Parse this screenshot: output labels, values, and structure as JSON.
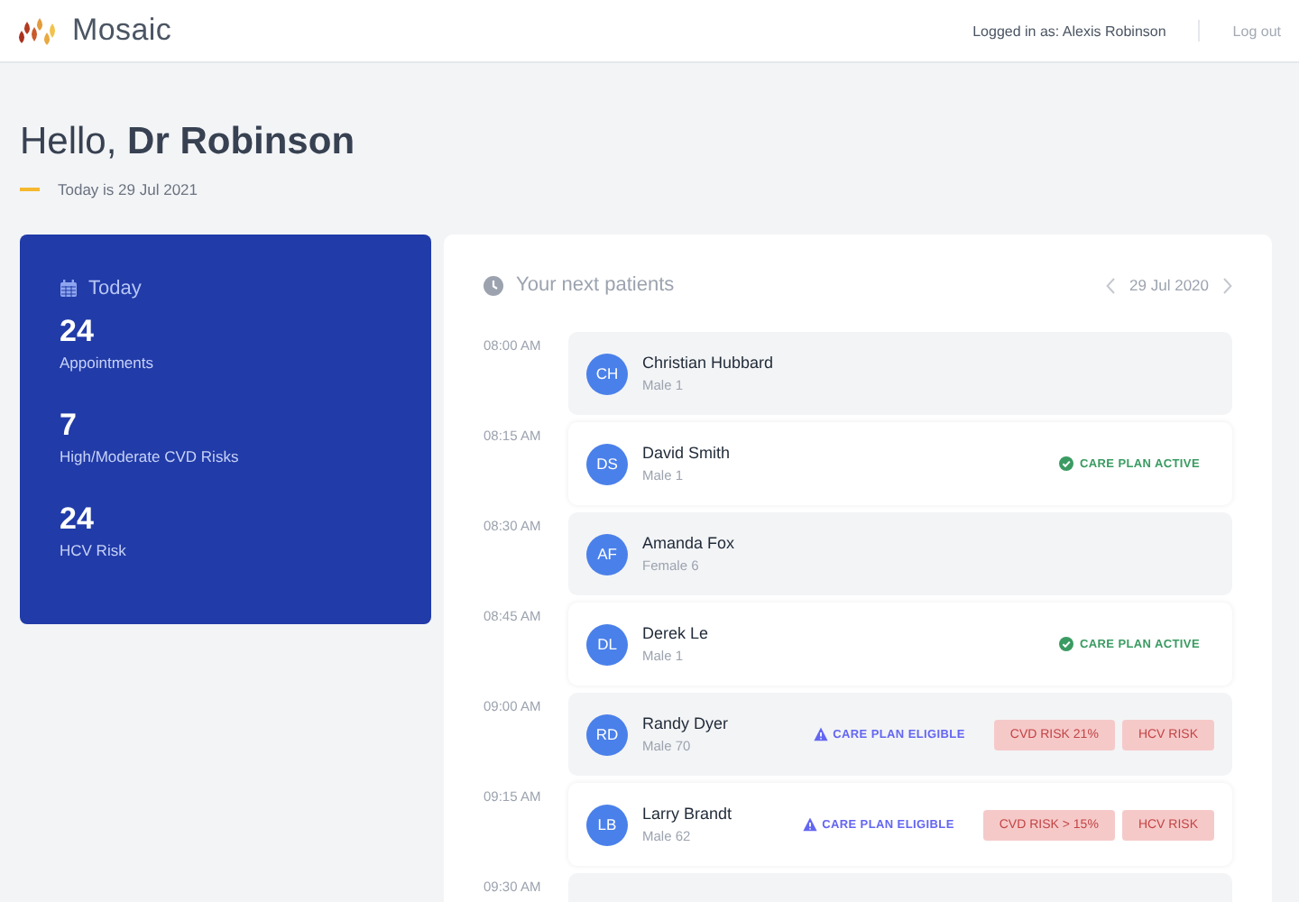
{
  "header": {
    "brand": "Mosaic",
    "logged_in": "Logged in as: Alexis Robinson",
    "logout": "Log out"
  },
  "greeting": {
    "text": "Hello, **Dr Robinson**",
    "date": "Today is 29 Jul 2021"
  },
  "today": {
    "title": "Today",
    "stats": [
      {
        "value": "24",
        "label": "Appointments"
      },
      {
        "value": "7",
        "label": "High/Moderate CVD Risks"
      },
      {
        "value": "24",
        "label": "HCV Risk"
      }
    ]
  },
  "patients": {
    "title": "Your next patients",
    "date": "29 Jul 2020",
    "slots": [
      {
        "time": "08:00 AM",
        "initials": "CH",
        "name": "Christian Hubbard",
        "detail": "Male 1"
      },
      {
        "time": "08:15 AM",
        "initials": "DS",
        "name": "David Smith",
        "detail": "Male 1",
        "care_plan": {
          "kind": "active",
          "label": "CARE PLAN ACTIVE"
        }
      },
      {
        "time": "08:30 AM",
        "initials": "AF",
        "name": "Amanda Fox",
        "detail": "Female 6"
      },
      {
        "time": "08:45 AM",
        "initials": "DL",
        "name": "Derek Le",
        "detail": "Male 1",
        "care_plan": {
          "kind": "active",
          "label": "CARE PLAN ACTIVE"
        }
      },
      {
        "time": "09:00 AM",
        "initials": "RD",
        "name": "Randy Dyer",
        "detail": "Male 70",
        "care_plan": {
          "kind": "eligible",
          "label": "CARE PLAN ELIGIBLE"
        },
        "risks": [
          "CVD RISK 21%",
          "HCV RISK"
        ]
      },
      {
        "time": "09:15 AM",
        "initials": "LB",
        "name": "Larry Brandt",
        "detail": "Male 62",
        "care_plan": {
          "kind": "eligible",
          "label": "CARE PLAN ELIGIBLE"
        },
        "risks": [
          "CVD RISK > 15%",
          "HCV RISK"
        ]
      },
      {
        "time": "09:30 AM"
      }
    ]
  }
}
